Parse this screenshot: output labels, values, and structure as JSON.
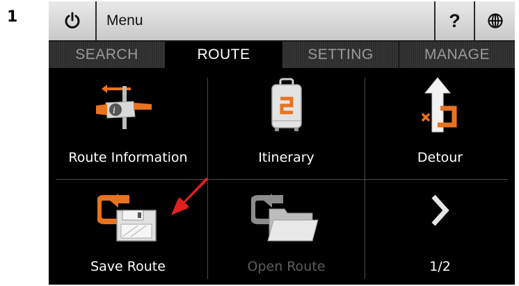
{
  "step_number": "1",
  "titlebar": {
    "power_icon": "power-icon",
    "menu_label": "Menu",
    "help_label": "?",
    "globe_icon": "globe-icon"
  },
  "tabs": [
    {
      "label": "SEARCH",
      "active": false
    },
    {
      "label": "ROUTE",
      "active": true
    },
    {
      "label": "SETTING",
      "active": false
    },
    {
      "label": "MANAGE",
      "active": false
    }
  ],
  "grid": {
    "items": [
      {
        "label": "Route Information",
        "icon": "route-information-icon",
        "enabled": true
      },
      {
        "label": "Itinerary",
        "icon": "itinerary-icon",
        "enabled": true
      },
      {
        "label": "Detour",
        "icon": "detour-icon",
        "enabled": true
      },
      {
        "label": "Save Route",
        "icon": "save-route-icon",
        "enabled": true
      },
      {
        "label": "Open Route",
        "icon": "open-route-icon",
        "enabled": false
      },
      {
        "label": "1/2",
        "icon": "next-page-icon",
        "enabled": true
      }
    ]
  },
  "annotation": {
    "icon": "red-arrow-icon",
    "color": "#e02020"
  },
  "colors": {
    "accent_orange": "#e8731f",
    "background": "#000000",
    "disabled_text": "#5e5e5e"
  }
}
